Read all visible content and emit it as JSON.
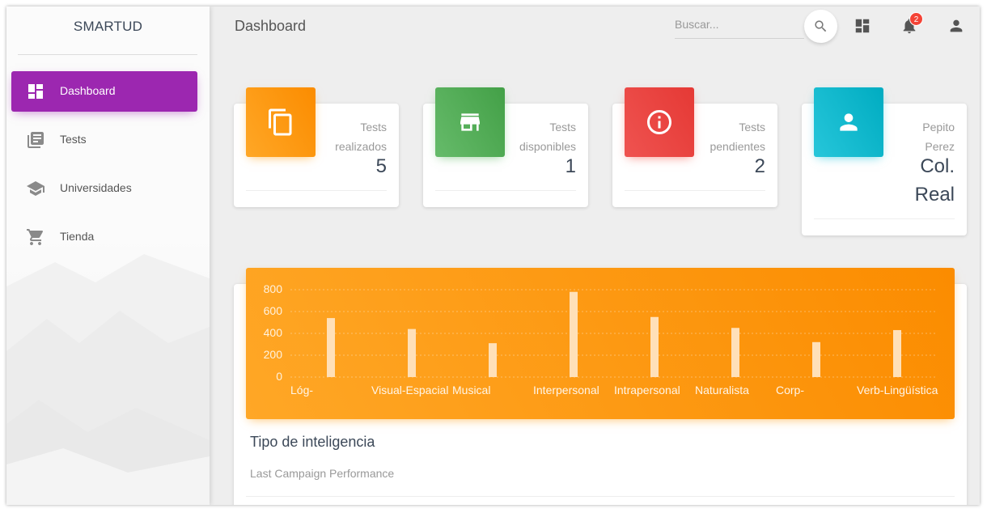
{
  "sidebar": {
    "brand": "SMARTUD",
    "items": [
      {
        "label": "Dashboard",
        "icon": "dashboard-icon",
        "active": true
      },
      {
        "label": "Tests",
        "icon": "library-books-icon",
        "active": false
      },
      {
        "label": "Universidades",
        "icon": "school-icon",
        "active": false
      },
      {
        "label": "Tienda",
        "icon": "shopping-cart-icon",
        "active": false
      }
    ]
  },
  "header": {
    "title": "Dashboard",
    "search_placeholder": "Buscar...",
    "notification_count": "2"
  },
  "cards": [
    {
      "category_line1": "Tests",
      "category_line2": "realizados",
      "value": "5",
      "icon": "content-copy-icon",
      "color": "#fb8c00"
    },
    {
      "category_line1": "Tests",
      "category_line2": "disponibles",
      "value": "1",
      "icon": "store-icon",
      "color": "#43a047"
    },
    {
      "category_line1": "Tests",
      "category_line2": "pendientes",
      "value": "2",
      "icon": "info-icon",
      "color": "#e53935"
    },
    {
      "category_line1": "Pepito",
      "category_line2": "Perez",
      "value_line1": "Col.",
      "value_line2": "Real",
      "icon": "person-icon",
      "color": "#00acc1"
    }
  ],
  "chart": {
    "title": "Tipo de inteligencia",
    "subtitle": "Last Campaign Performance"
  },
  "chart_data": {
    "type": "bar",
    "categories": [
      "Lóg-",
      "Visual-Espacial",
      "Musical",
      "Interpersonal",
      "Intrapersonal",
      "Naturalista",
      "Corp-",
      "Verb-Lingüística"
    ],
    "values": [
      540,
      440,
      310,
      780,
      550,
      450,
      320,
      430
    ],
    "ylim": [
      0,
      800
    ],
    "yticks": [
      "800",
      "600",
      "400",
      "200",
      "0"
    ],
    "grid": true
  },
  "colors": {
    "accent": "#9c27b0",
    "chart_bg": "#fb8c00",
    "bar": "#ffe0b8"
  }
}
